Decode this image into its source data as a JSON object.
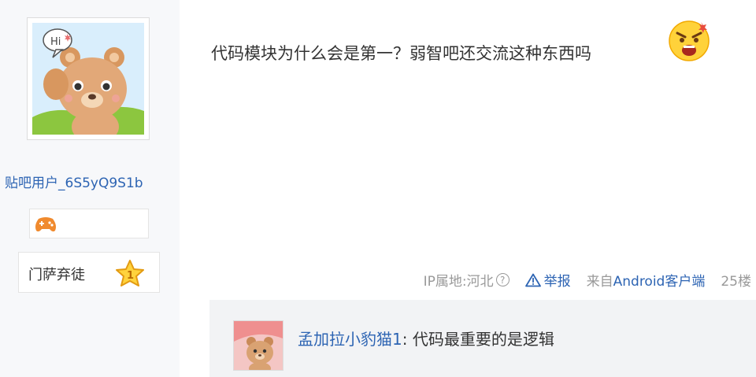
{
  "user": {
    "avatar": "bear-hi-avatar",
    "avatar_bubble": "Hi",
    "name": "贴吧用户_6S5yQ9S1b",
    "badge_icon": "gamepad-icon",
    "level_name": "门萨弃徒",
    "level_number": "1"
  },
  "post": {
    "content": "代码模块为什么会是第一？弱智吧还交流这种东西吗",
    "emoji": "angry-face-emoji",
    "meta": {
      "ip_location": "IP属地:河北",
      "help_symbol": "?",
      "report_label": "举报",
      "from_prefix": "来自",
      "client": "Android客户端",
      "floor": "25楼"
    }
  },
  "reply": {
    "avatar": "bear-reply-avatar",
    "user": "孟加拉小豹猫1",
    "colon": ": ",
    "text": "代码最重要的是逻辑"
  },
  "colors": {
    "link_blue": "#2d64b3",
    "meta_gray": "#999999",
    "reply_bg": "#f2f3f5"
  }
}
